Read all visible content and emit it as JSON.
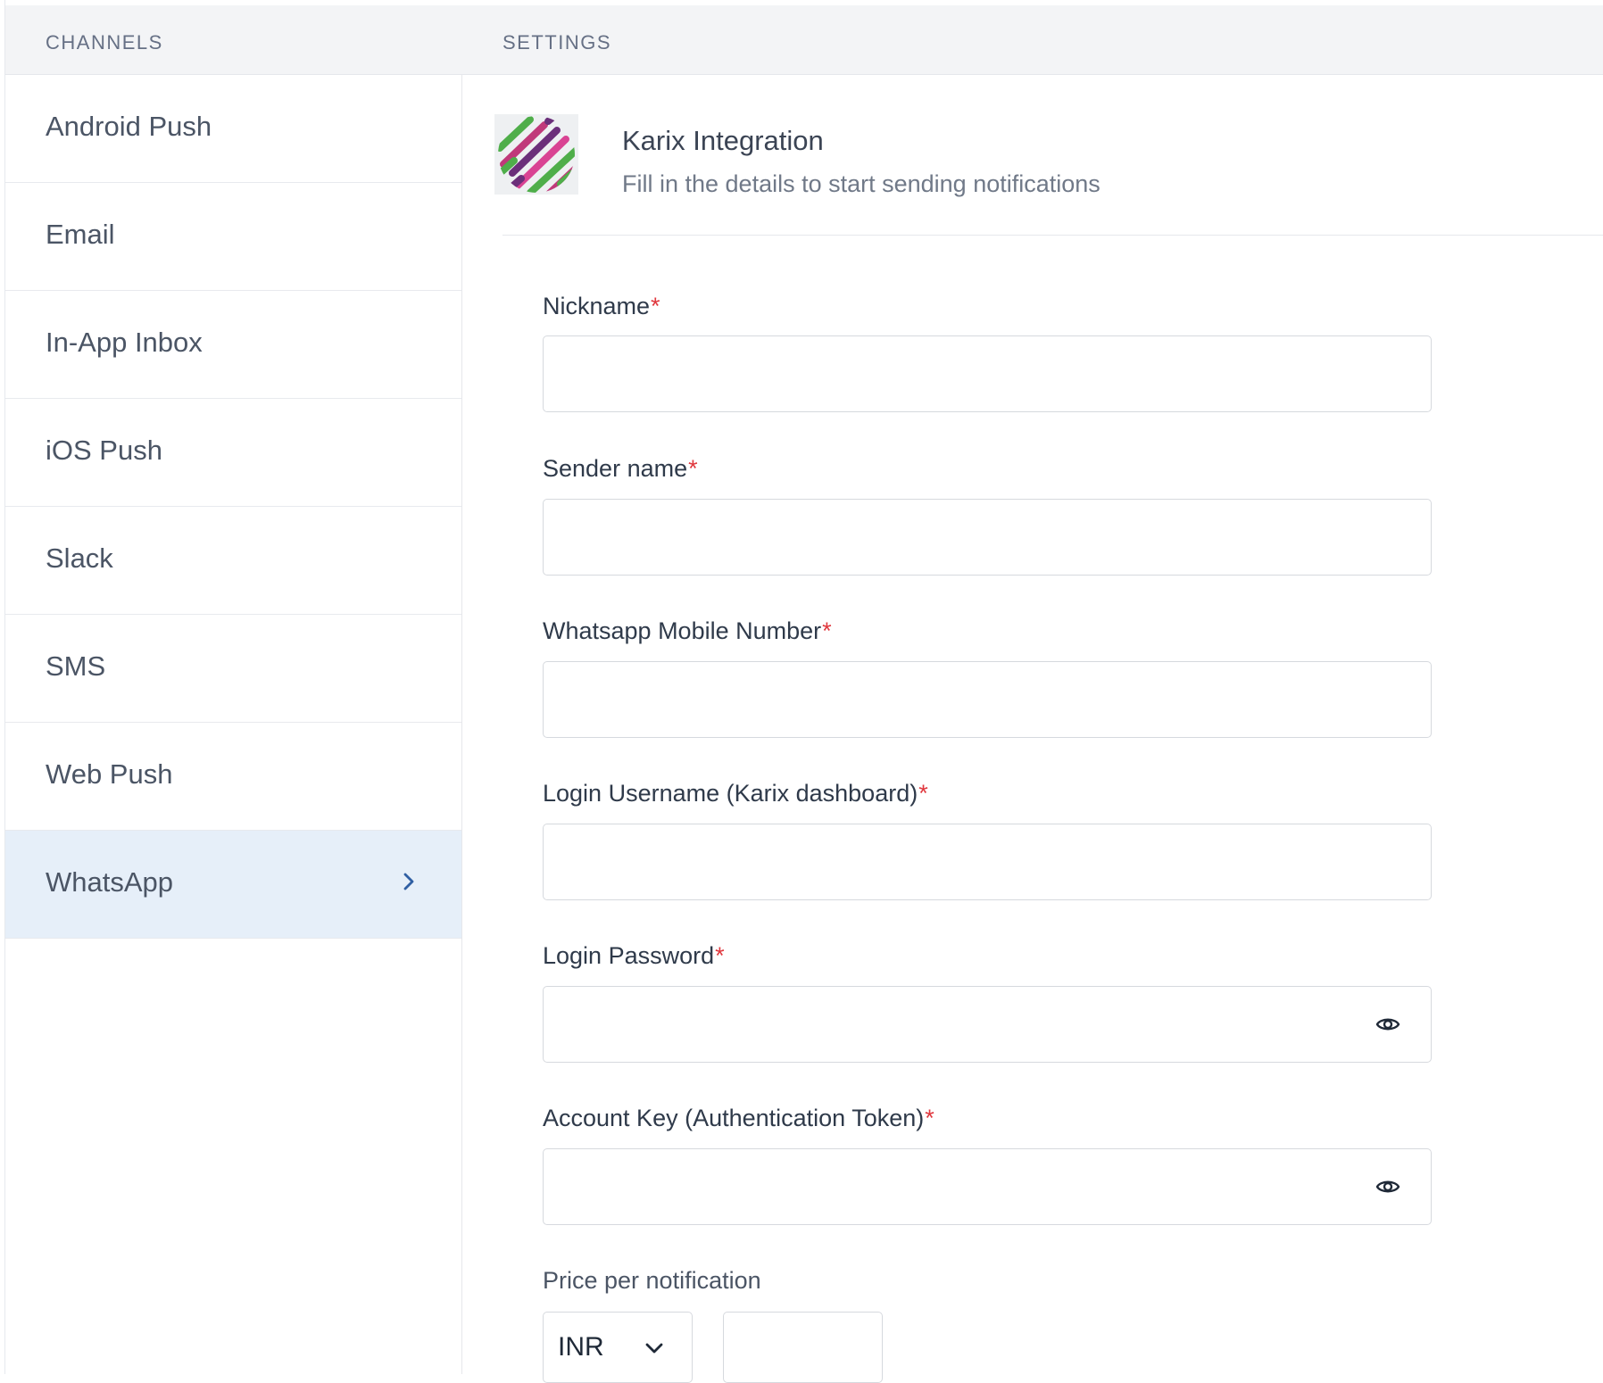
{
  "header": {
    "channels_label": "CHANNELS",
    "settings_label": "SETTINGS"
  },
  "sidebar": {
    "items": [
      {
        "label": "Android Push",
        "active": false
      },
      {
        "label": "Email",
        "active": false
      },
      {
        "label": "In-App Inbox",
        "active": false
      },
      {
        "label": "iOS Push",
        "active": false
      },
      {
        "label": "Slack",
        "active": false
      },
      {
        "label": "SMS",
        "active": false
      },
      {
        "label": "Web Push",
        "active": false
      },
      {
        "label": "WhatsApp",
        "active": true
      }
    ]
  },
  "integration": {
    "logo_icon": "karix-logo-icon",
    "title": "Karix Integration",
    "subtitle": "Fill in the details to start sending notifications"
  },
  "form": {
    "required_marker": "*",
    "fields": [
      {
        "label": "Nickname",
        "required": true,
        "value": "",
        "type": "text"
      },
      {
        "label": "Sender name",
        "required": true,
        "value": "",
        "type": "text"
      },
      {
        "label": "Whatsapp Mobile Number",
        "required": true,
        "value": "",
        "type": "text"
      },
      {
        "label": "Login Username (Karix dashboard)",
        "required": true,
        "value": "",
        "type": "text"
      },
      {
        "label": "Login Password",
        "required": true,
        "value": "",
        "type": "password"
      },
      {
        "label": "Account Key (Authentication Token)",
        "required": true,
        "value": "",
        "type": "password"
      }
    ],
    "price": {
      "label": "Price per notification",
      "currency": "INR",
      "value": ""
    }
  },
  "colors": {
    "active_item_bg": "#e6eff9",
    "required_star": "#e0383e",
    "header_bg": "#f3f4f6",
    "chevron_accent": "#2f5fa3"
  }
}
